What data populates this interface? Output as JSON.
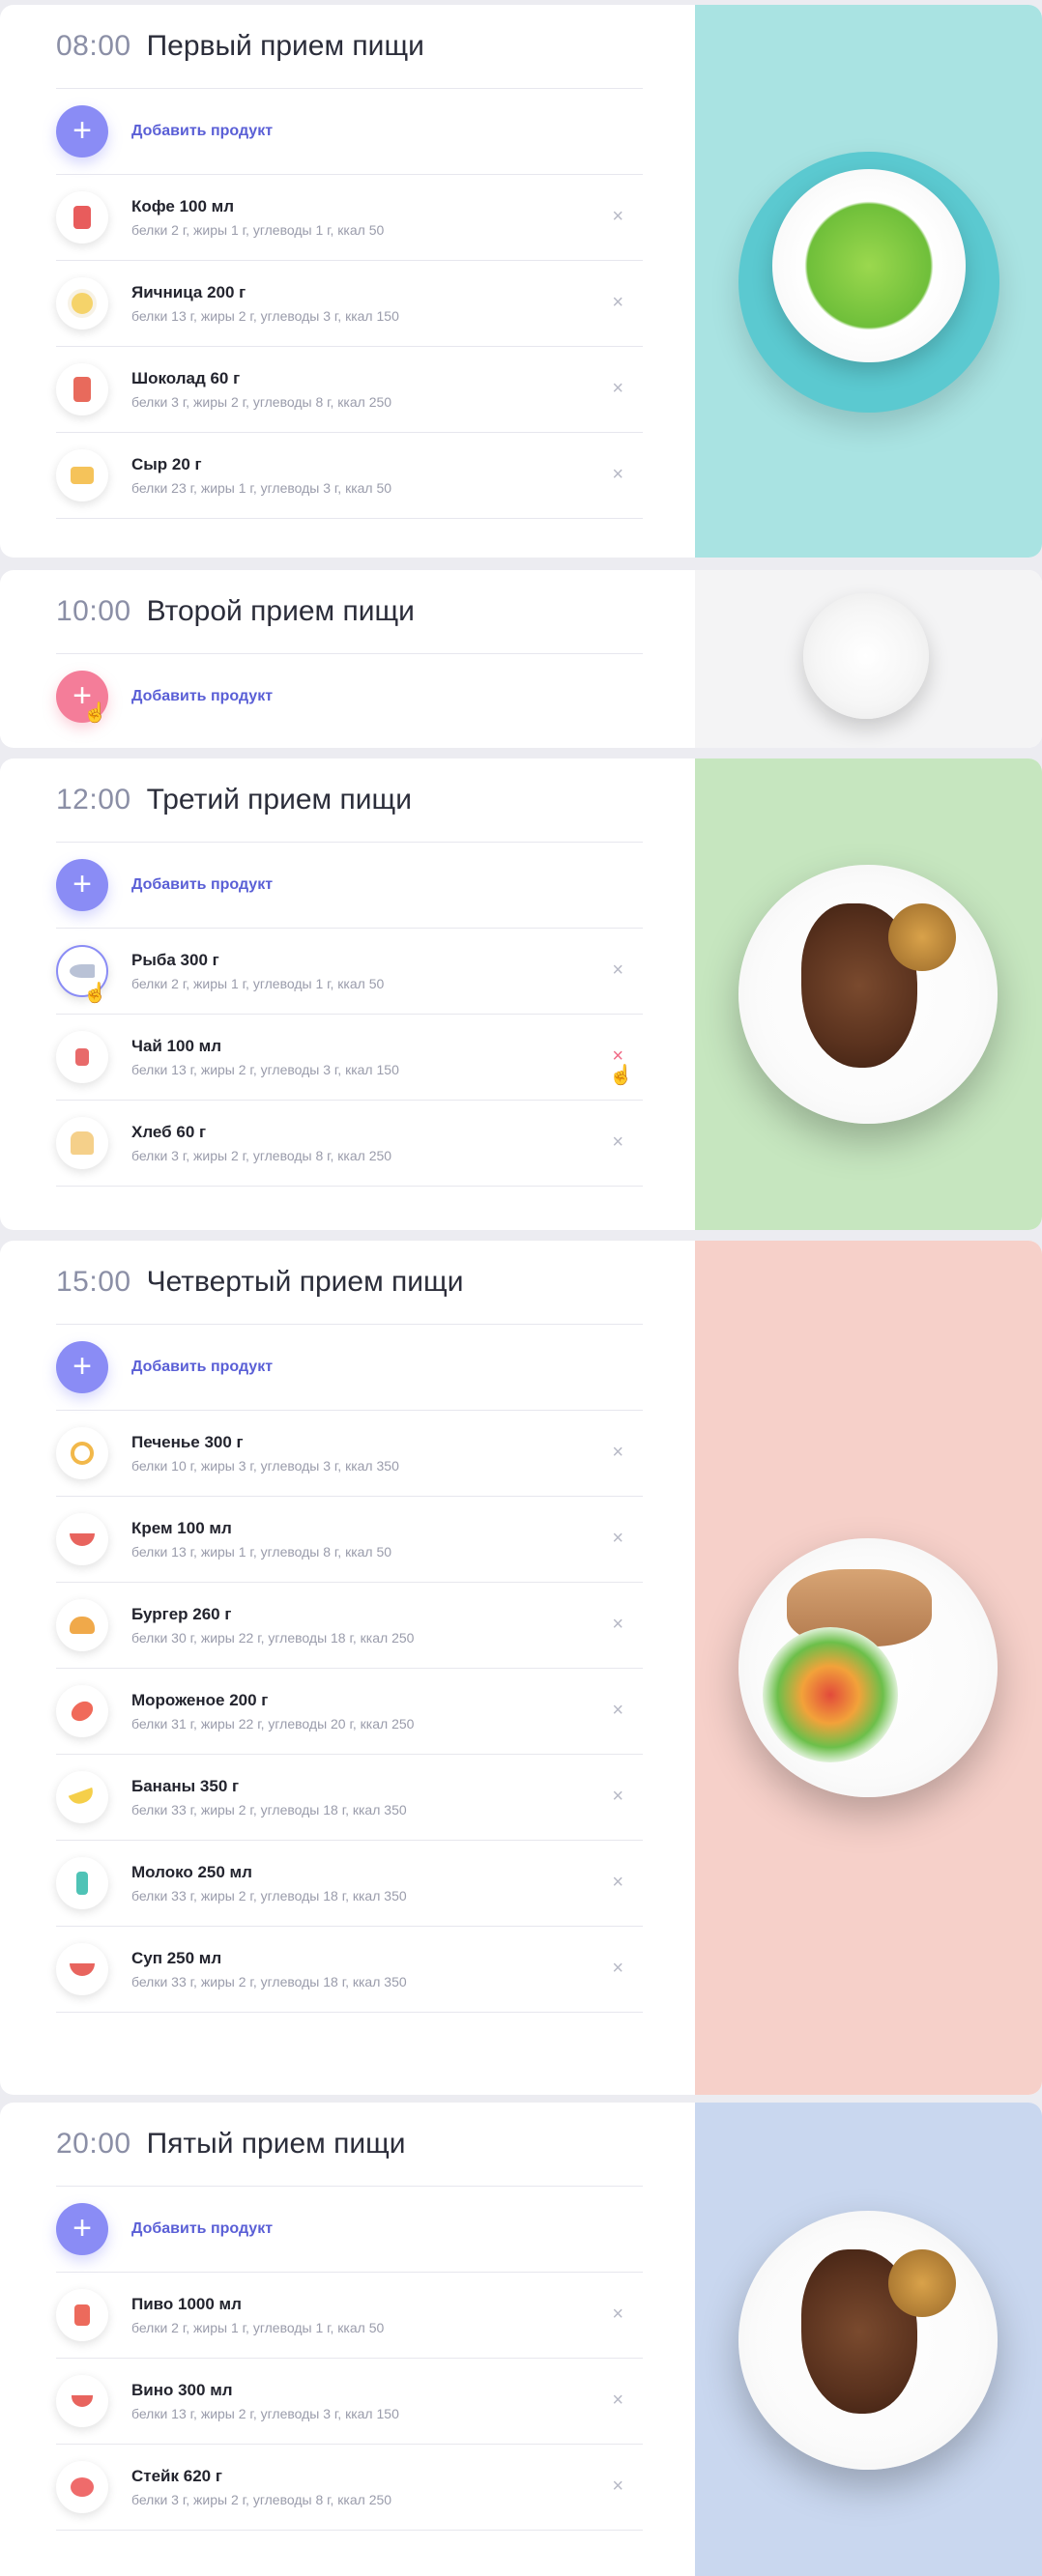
{
  "common": {
    "add_label": "Добавить продукт",
    "remove_glyph": "×"
  },
  "meals": [
    {
      "time": "08:00",
      "title": "Первый прием пищи",
      "side_color": "#a9e3e2",
      "items": [
        {
          "name": "Кофе 100 мл",
          "desc": "белки 2 г, жиры 1 г, углеводы 1 г, ккал 50",
          "icon": "coffee-cup-icon",
          "color": "#e85c5c"
        },
        {
          "name": "Яичница 200 г",
          "desc": "белки 13 г, жиры 2 г, углеводы 3 г, ккал 150",
          "icon": "fried-egg-icon",
          "color": "#f5d36a"
        },
        {
          "name": "Шоколад 60 г",
          "desc": "белки 3 г, жиры 2 г, углеводы 8 г, ккал 250",
          "icon": "chocolate-bar-icon",
          "color": "#e86a5c"
        },
        {
          "name": "Сыр 20 г",
          "desc": "белки 23 г, жиры 1 г, углеводы 3 г, ккал 50",
          "icon": "cheese-icon",
          "color": "#f5c35a"
        }
      ]
    },
    {
      "time": "10:00",
      "title": "Второй прием пищи",
      "side_color": "#f4f4f5",
      "items": []
    },
    {
      "time": "12:00",
      "title": "Третий прием пищи",
      "side_color": "#c6e6bf",
      "items": [
        {
          "name": "Рыба 300 г",
          "desc": "белки 2 г, жиры 1 г, углеводы 1 г, ккал 50",
          "icon": "fish-icon",
          "color": "#b9c2d6"
        },
        {
          "name": "Чай 100 мл",
          "desc": "белки 13 г, жиры 2 г, углеводы 3 г, ккал 150",
          "icon": "tea-cup-icon",
          "color": "#e86a6a"
        },
        {
          "name": "Хлеб 60 г",
          "desc": "белки 3 г, жиры 2 г, углеводы 8 г, ккал 250",
          "icon": "bread-icon",
          "color": "#f5d08a"
        }
      ]
    },
    {
      "time": "15:00",
      "title": "Четвертый прием пищи",
      "side_color": "#f6d0c9",
      "items": [
        {
          "name": "Печенье 300 г",
          "desc": "белки 10 г, жиры 3 г, углеводы 3 г, ккал 350",
          "icon": "pretzel-icon",
          "color": "#f2b84a"
        },
        {
          "name": "Крем 100 мл",
          "desc": "белки 13 г, жиры 1 г, углеводы 8 г, ккал 50",
          "icon": "cream-bowl-icon",
          "color": "#e8645e"
        },
        {
          "name": "Бургер 260 г",
          "desc": "белки 30 г, жиры 22 г, углеводы 18 г, ккал 250",
          "icon": "burger-icon",
          "color": "#f0a94a"
        },
        {
          "name": "Мороженое 200 г",
          "desc": "белки 31 г, жиры 22 г, углеводы 20 г, ккал 250",
          "icon": "ice-cream-icon",
          "color": "#f06a5a"
        },
        {
          "name": "Бананы 350 г",
          "desc": "белки 33 г, жиры 2 г, углеводы 18 г, ккал 350",
          "icon": "banana-icon",
          "color": "#f5cf4a"
        },
        {
          "name": "Молоко 250 мл",
          "desc": "белки 33 г, жиры 2 г, углеводы 18 г, ккал 350",
          "icon": "milk-bottle-icon",
          "color": "#4fc3b6"
        },
        {
          "name": "Суп 250 мл",
          "desc": "белки 33 г, жиры 2 г, углеводы 18 г, ккал 350",
          "icon": "soup-bowl-icon",
          "color": "#e8645e"
        }
      ]
    },
    {
      "time": "20:00",
      "title": "Пятый прием пищи",
      "side_color": "#c9d7ef",
      "items": [
        {
          "name": "Пиво 1000 мл",
          "desc": "белки 2 г, жиры 1 г, углеводы 1 г, ккал 50",
          "icon": "beer-mug-icon",
          "color": "#ec6a5c"
        },
        {
          "name": "Вино 300 мл",
          "desc": "белки 13 г, жиры 2 г, углеводы 3 г, ккал 150",
          "icon": "wine-glass-icon",
          "color": "#e8645e"
        },
        {
          "name": "Стейк 620 г",
          "desc": "белки 3 г, жиры 2 г, углеводы 8 г, ккал 250",
          "icon": "steak-icon",
          "color": "#ef6b6b"
        }
      ]
    }
  ]
}
